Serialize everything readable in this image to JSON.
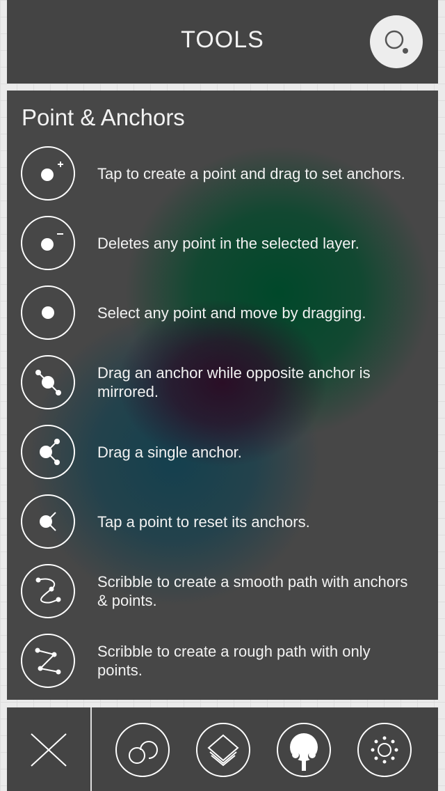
{
  "header": {
    "title": "TOOLS",
    "search_icon": "search-icon"
  },
  "section": {
    "title": "Point & Anchors"
  },
  "tools": [
    {
      "icon": "add-point-icon",
      "description": "Tap to create a point and drag to set anchors."
    },
    {
      "icon": "delete-point-icon",
      "description": "Deletes any point in the selected layer."
    },
    {
      "icon": "select-point-icon",
      "description": "Select any point and move by dragging."
    },
    {
      "icon": "mirror-anchor-icon",
      "description": "Drag an anchor while opposite anchor is mirrored."
    },
    {
      "icon": "single-anchor-icon",
      "description": "Drag a single anchor."
    },
    {
      "icon": "reset-anchors-icon",
      "description": "Tap a point to reset its anchors."
    },
    {
      "icon": "smooth-scribble-icon",
      "description": "Scribble to create a smooth path with anchors & points."
    },
    {
      "icon": "rough-scribble-icon",
      "description": "Scribble to create a rough path with only points."
    }
  ],
  "tabbar": {
    "close_icon": "close-icon",
    "tabs": [
      {
        "icon": "shapes-icon"
      },
      {
        "icon": "layers-icon"
      },
      {
        "icon": "tree-icon"
      },
      {
        "icon": "settings-icon"
      }
    ]
  },
  "colors": {
    "panel": "#474747",
    "header": "#444444",
    "background": "#ebebeb",
    "foreground": "#ffffff"
  }
}
